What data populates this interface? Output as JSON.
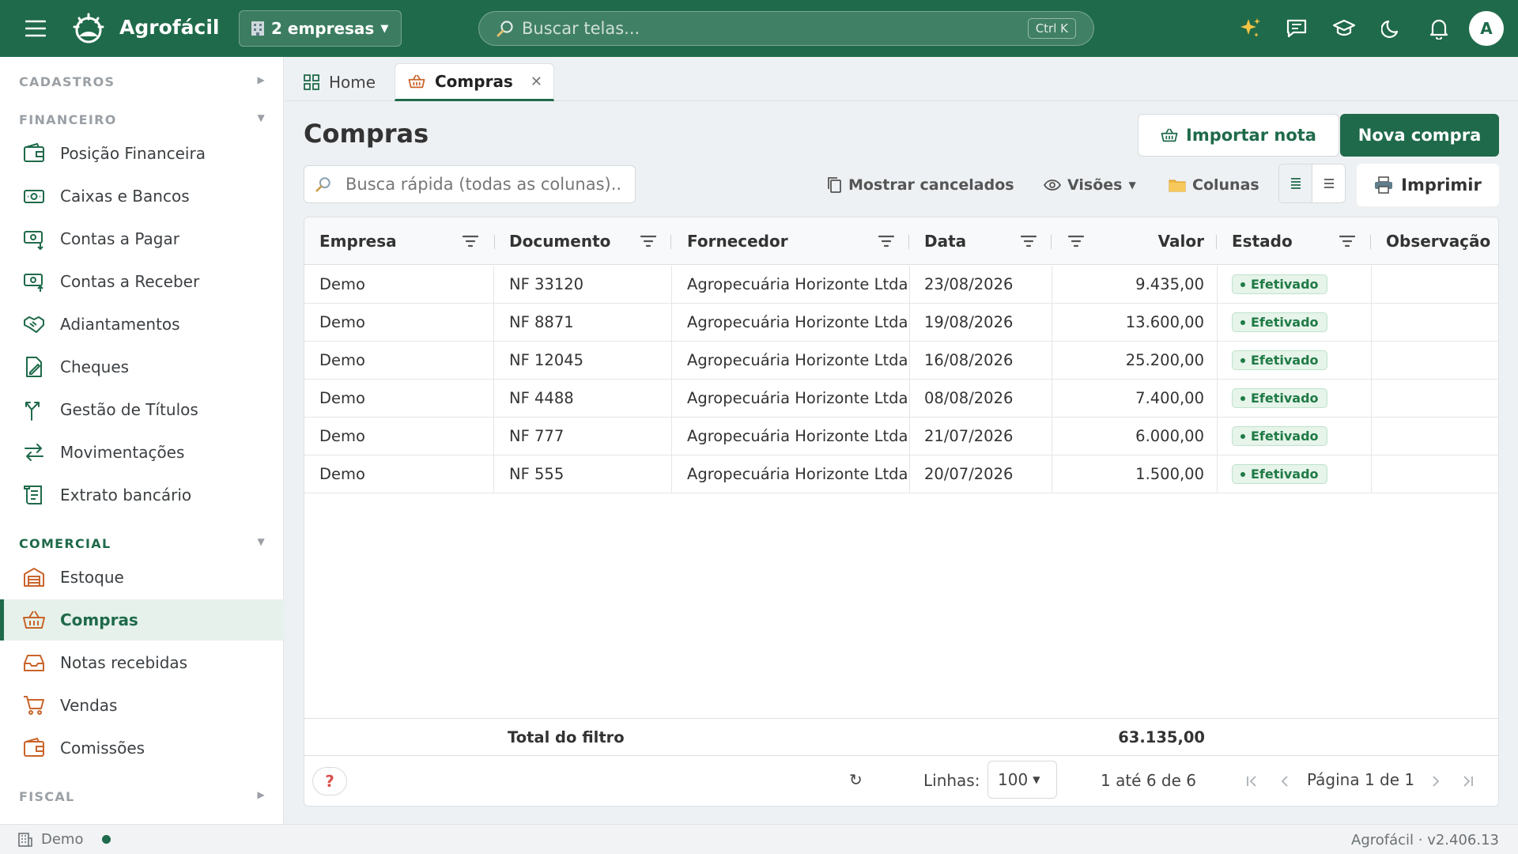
{
  "header": {
    "brand": "Agrofácil",
    "company_selector": "2 empresas",
    "search_placeholder": "Buscar telas...",
    "search_shortcut": "Ctrl K",
    "avatar_initial": "A"
  },
  "sidebar": {
    "sections": {
      "cadastros": "CADASTROS",
      "financeiro": "FINANCEIRO",
      "comercial": "COMERCIAL",
      "fiscal": "FISCAL"
    },
    "financeiro_items": [
      {
        "label": "Posição Financeira",
        "icon": "wallet-icon"
      },
      {
        "label": "Caixas e Bancos",
        "icon": "cash-icon"
      },
      {
        "label": "Contas a Pagar",
        "icon": "bill-pay-icon"
      },
      {
        "label": "Contas a Receber",
        "icon": "bill-receive-icon"
      },
      {
        "label": "Adiantamentos",
        "icon": "handshake-icon"
      },
      {
        "label": "Cheques",
        "icon": "check-document-icon"
      },
      {
        "label": "Gestão de Títulos",
        "icon": "branch-icon"
      },
      {
        "label": "Movimentações",
        "icon": "transfer-icon"
      },
      {
        "label": "Extrato bancário",
        "icon": "receipt-icon"
      }
    ],
    "comercial_items": [
      {
        "label": "Estoque",
        "icon": "warehouse-icon"
      },
      {
        "label": "Compras",
        "icon": "basket-icon",
        "active": true
      },
      {
        "label": "Notas recebidas",
        "icon": "inbox-icon"
      },
      {
        "label": "Vendas",
        "icon": "cart-icon"
      },
      {
        "label": "Comissões",
        "icon": "wallet-icon"
      }
    ]
  },
  "tabs": [
    {
      "label": "Home",
      "icon": "grid-icon"
    },
    {
      "label": "Compras",
      "icon": "basket-icon",
      "active": true
    }
  ],
  "page": {
    "title": "Compras",
    "import_button": "Importar nota",
    "new_button": "Nova compra",
    "quick_search_placeholder": "Busca rápida (todas as colunas)..",
    "show_cancelled": "Mostrar cancelados",
    "views": "Visões",
    "columns": "Colunas",
    "print": "Imprimir"
  },
  "grid": {
    "columns": [
      "Empresa",
      "Documento",
      "Fornecedor",
      "Data",
      "Valor",
      "Estado",
      "Observação"
    ],
    "rows": [
      {
        "empresa": "Demo",
        "documento": "NF 33120",
        "fornecedor": "Agropecuária Horizonte Ltda",
        "data": "23/08/2026",
        "valor": "9.435,00",
        "estado": "Efetivado"
      },
      {
        "empresa": "Demo",
        "documento": "NF 8871",
        "fornecedor": "Agropecuária Horizonte Ltda",
        "data": "19/08/2026",
        "valor": "13.600,00",
        "estado": "Efetivado"
      },
      {
        "empresa": "Demo",
        "documento": "NF 12045",
        "fornecedor": "Agropecuária Horizonte Ltda",
        "data": "16/08/2026",
        "valor": "25.200,00",
        "estado": "Efetivado"
      },
      {
        "empresa": "Demo",
        "documento": "NF 4488",
        "fornecedor": "Agropecuária Horizonte Ltda",
        "data": "08/08/2026",
        "valor": "7.400,00",
        "estado": "Efetivado"
      },
      {
        "empresa": "Demo",
        "documento": "NF 777",
        "fornecedor": "Agropecuária Horizonte Ltda",
        "data": "21/07/2026",
        "valor": "6.000,00",
        "estado": "Efetivado"
      },
      {
        "empresa": "Demo",
        "documento": "NF 555",
        "fornecedor": "Agropecuária Horizonte Ltda",
        "data": "20/07/2026",
        "valor": "1.500,00",
        "estado": "Efetivado"
      }
    ],
    "total_label": "Total do filtro",
    "total_value": "63.135,00"
  },
  "footer": {
    "help": "?",
    "refresh_icon": "↻",
    "rows_label": "Linhas:",
    "rows_value": "100",
    "range": "1 até 6 de 6",
    "page": "Página 1 de 1"
  },
  "statusbar": {
    "company": "Demo",
    "version": "Agrofácil · v2.406.13"
  },
  "colors": {
    "brand_green": "#1f6a4a",
    "status_green": "#1f7a45",
    "accent_orange": "#c9642a"
  }
}
